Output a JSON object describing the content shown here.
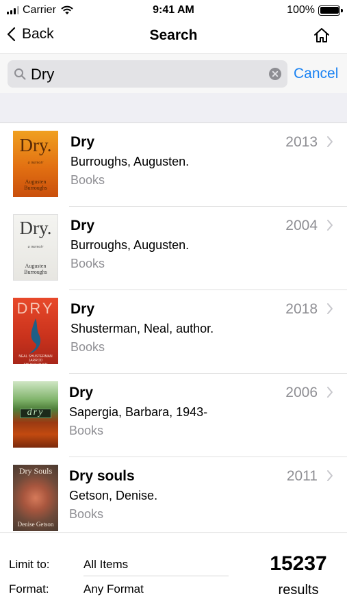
{
  "status": {
    "carrier": "Carrier",
    "time": "9:41 AM",
    "battery": "100%"
  },
  "nav": {
    "back_label": "Back",
    "title": "Search"
  },
  "search": {
    "query": "Dry",
    "cancel_label": "Cancel"
  },
  "results": [
    {
      "title": "Dry",
      "author": "Burroughs, Augusten.",
      "type": "Books",
      "year": "2013"
    },
    {
      "title": "Dry",
      "author": "Burroughs, Augusten.",
      "type": "Books",
      "year": "2004"
    },
    {
      "title": "Dry",
      "author": "Shusterman, Neal, author.",
      "type": "Books",
      "year": "2018"
    },
    {
      "title": "Dry",
      "author": "Sapergia, Barbara, 1943-",
      "type": "Books",
      "year": "2006"
    },
    {
      "title": "Dry souls",
      "author": "Getson, Denise.",
      "type": "Books",
      "year": "2011"
    }
  ],
  "covers": {
    "c1": {
      "title": "Dry.",
      "subtitle": "a memoir",
      "author": "Augusten Burroughs"
    },
    "c2": {
      "title": "Dry.",
      "subtitle": "a memoir",
      "author": "Augusten Burroughs"
    },
    "c3": {
      "title": "DRY",
      "author": "NEAL SHUSTERMAN JARROD SHUSTERMAN"
    },
    "c4": {
      "title": "dry"
    },
    "c5": {
      "title": "Dry Souls",
      "author": "Denise Getson"
    }
  },
  "filters": {
    "limit_label": "Limit to:",
    "limit_value": "All Items",
    "format_label": "Format:",
    "format_value": "Any Format"
  },
  "summary": {
    "count": "15237",
    "count_label": "results"
  },
  "colors": {
    "accent": "#1a82f2",
    "secondary_text": "#8e8e93",
    "section_bg": "#efeff4"
  }
}
